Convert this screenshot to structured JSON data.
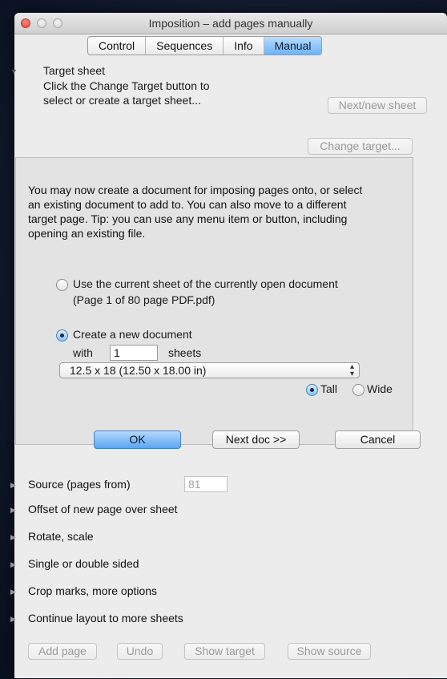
{
  "window": {
    "title": "Imposition – add pages manually"
  },
  "tabs": [
    {
      "label": "Control",
      "selected": false
    },
    {
      "label": "Sequences",
      "selected": false
    },
    {
      "label": "Info",
      "selected": false
    },
    {
      "label": "Manual",
      "selected": true
    }
  ],
  "target": {
    "heading": "Target sheet",
    "desc_line1": "Click the Change Target button to",
    "desc_line2": "select or create a target sheet...",
    "next_new_sheet": "Next/new sheet",
    "change_target": "Change target..."
  },
  "panel": {
    "para_lines": [
      "You may now create a document for imposing pages onto, or select",
      "an existing document to add to. You can also move to a different",
      "target page. Tip: you can use any menu item or button, including",
      "opening an existing file."
    ],
    "option_current": "Use the current sheet of the currently open document",
    "option_current_sub": "(Page 1 of 80 page PDF.pdf)",
    "option_new": "Create a new document",
    "with_label": "with",
    "sheets_value": "1",
    "sheets_label": "sheets",
    "size_selected": "12.5 x 18 (12.50 x 18.00 in)",
    "orientation_tall": "Tall",
    "orientation_wide": "Wide",
    "orientation_selected": "Tall",
    "ok": "OK",
    "next_doc": "Next doc >>",
    "cancel": "Cancel"
  },
  "sections": {
    "source": "Source (pages from)",
    "source_value": "81",
    "offset": "Offset of new page over sheet",
    "rotate": "Rotate, scale",
    "sided": "Single or double sided",
    "crop": "Crop marks, more options",
    "continue": "Continue layout to more sheets"
  },
  "bottom": {
    "add_page": "Add page",
    "undo": "Undo",
    "show_target": "Show target",
    "show_source": "Show source"
  },
  "icons": {
    "disclosure_open": "triangle-down-icon",
    "disclosure_closed": "triangle-right-icon",
    "popup_arrows": "updown-arrows-icon"
  },
  "colors": {
    "selected_tab": "#6eb4f6",
    "default_button": "#5aa6f0",
    "close_light": "#e0443e"
  }
}
